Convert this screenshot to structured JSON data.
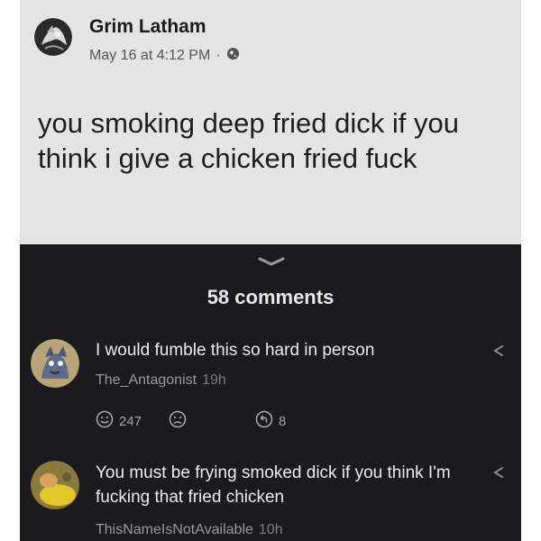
{
  "post": {
    "author": "Grim Latham",
    "timestamp": "May 16 at 4:12 PM",
    "separator": "·",
    "privacy_icon": "globe-icon",
    "text": "you smoking deep fried dick if you think i give a chicken fried fuck"
  },
  "comments_section": {
    "count_label": "58 comments",
    "collapse_icon": "chevron-down-icon",
    "comments": [
      {
        "text": "I would fumble this so hard in person",
        "username": "The_Antagonist",
        "time": "19h",
        "upvotes": "247",
        "replies": "8"
      },
      {
        "text": "You must be frying smoked dick if you think I'm fucking that fried chicken",
        "username": "ThisNameIsNotAvailable",
        "time": "10h"
      }
    ]
  },
  "colors": {
    "post_bg": "#e4e4e4",
    "comments_bg": "#1b1b1d"
  }
}
